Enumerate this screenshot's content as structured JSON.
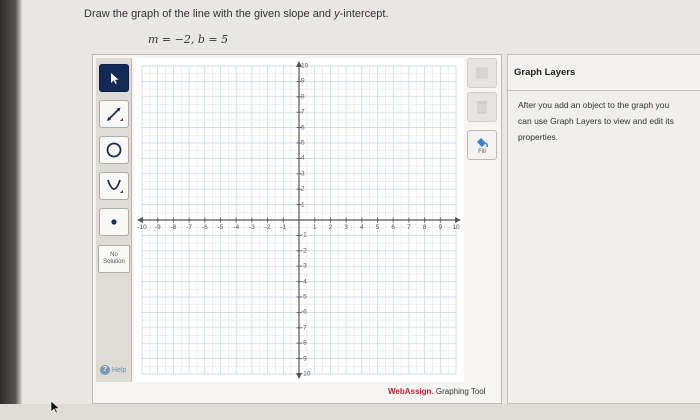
{
  "prompt": {
    "text_before": "Draw the graph of the line with the given slope and ",
    "text_italic": "y",
    "text_after": "-intercept."
  },
  "equation": "m = −2, b = 5",
  "toolbar": {
    "tools": [
      {
        "name": "pointer-tool",
        "icon": "arrow-pointer-icon",
        "active": true
      },
      {
        "name": "line-tool",
        "icon": "line-icon",
        "active": false
      },
      {
        "name": "circle-tool",
        "icon": "circle-icon",
        "active": false
      },
      {
        "name": "parabola-tool",
        "icon": "parabola-icon",
        "active": false
      },
      {
        "name": "point-tool",
        "icon": "point-icon",
        "active": false
      }
    ],
    "no_solution_line1": "No",
    "no_solution_line2": "Solution",
    "help_label": "Help"
  },
  "graph": {
    "x_range": [
      -10,
      10
    ],
    "y_range": [
      -10,
      10
    ],
    "x_ticks": [
      "-10",
      "-9",
      "-8",
      "-7",
      "-6",
      "-5",
      "-4",
      "-3",
      "-2",
      "-1",
      "1",
      "2",
      "3",
      "4",
      "5",
      "6",
      "7",
      "8",
      "9",
      "10"
    ],
    "y_ticks": [
      "10",
      "9",
      "8",
      "7",
      "6",
      "5",
      "4",
      "3",
      "2",
      "1",
      "-1",
      "-2",
      "-3",
      "-4",
      "-5",
      "-6",
      "-7",
      "-8",
      "-9",
      "-10"
    ],
    "grid": true
  },
  "right_tools": {
    "fill_label": "Fill"
  },
  "branding": {
    "brand": "WebAssign",
    "suffix": ". Graphing Tool"
  },
  "layers": {
    "title": "Graph Layers",
    "line1": "After you add an object to the graph you",
    "line2": "can use Graph Layers to view and edit its",
    "line3": "properties."
  },
  "colors": {
    "toolbar_active": "#132a56",
    "brand_red": "#b0282a",
    "fill_blue": "#3a7fc4"
  }
}
